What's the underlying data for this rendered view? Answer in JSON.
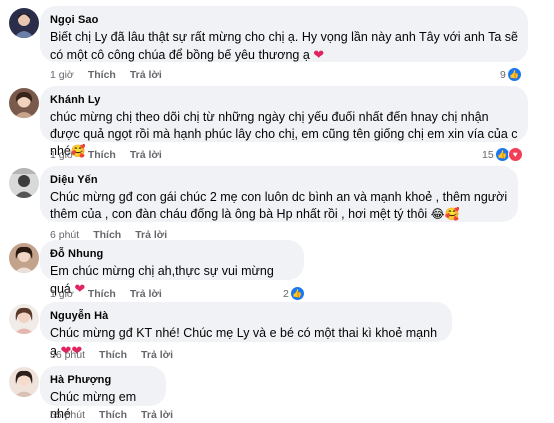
{
  "actions": {
    "like": "Thích",
    "reply": "Trả lời"
  },
  "comments": [
    {
      "author": "Ngọi Sao",
      "text": "Biết chị Ly đã lâu thật sự rất mừng cho chị ạ. Hy vọng lần này anh Tây với anh Ta sẽ có một cô công chúa để bồng bế yêu thương ạ",
      "emoji": "❤",
      "time": "1 giờ",
      "reactions": "9",
      "reaction_types": [
        "like"
      ]
    },
    {
      "author": "Khánh Ly",
      "text": "chúc mừng chị theo dõi chị từ những ngày chị yếu đuối nhất đến hnay chị nhận được quả ngọt rồi mà hạnh phúc lây cho chị, em cũng tên giống chị em xin vía của c nhé",
      "emoji": "🥰",
      "time": "1 giờ",
      "reactions": "15",
      "reaction_types": [
        "like",
        "love"
      ]
    },
    {
      "author": "Diệu Yến",
      "text": "Chúc mừng gđ con gái chúc 2 mẹ con luôn dc bình an và mạnh khoẻ , thêm người thêm của , con đàn cháu đống là ông bà Hp nhất rồi , hơi mệt tý thôi",
      "emoji": "😂🥰",
      "time": "6 phút",
      "reactions": "",
      "reaction_types": []
    },
    {
      "author": "Đỗ Nhung",
      "text": "Em chúc mừng chị ah,thực sự vui mừng quá",
      "emoji": "❤",
      "time": "1 giờ",
      "reactions": "2",
      "reaction_types": [
        "like"
      ]
    },
    {
      "author": "Nguyễn Hà",
      "text": "Chúc mừng gđ KT nhé! Chúc mẹ Ly và e bé có một thai kì khoẻ mạnh ạ",
      "emoji": "❤❤",
      "time": "36 phút",
      "reactions": "",
      "reaction_types": []
    },
    {
      "author": "Hà Phượng",
      "text": "Chúc mừng em nhé",
      "emoji": "",
      "time": "55 phút",
      "reactions": "",
      "reaction_types": []
    }
  ]
}
